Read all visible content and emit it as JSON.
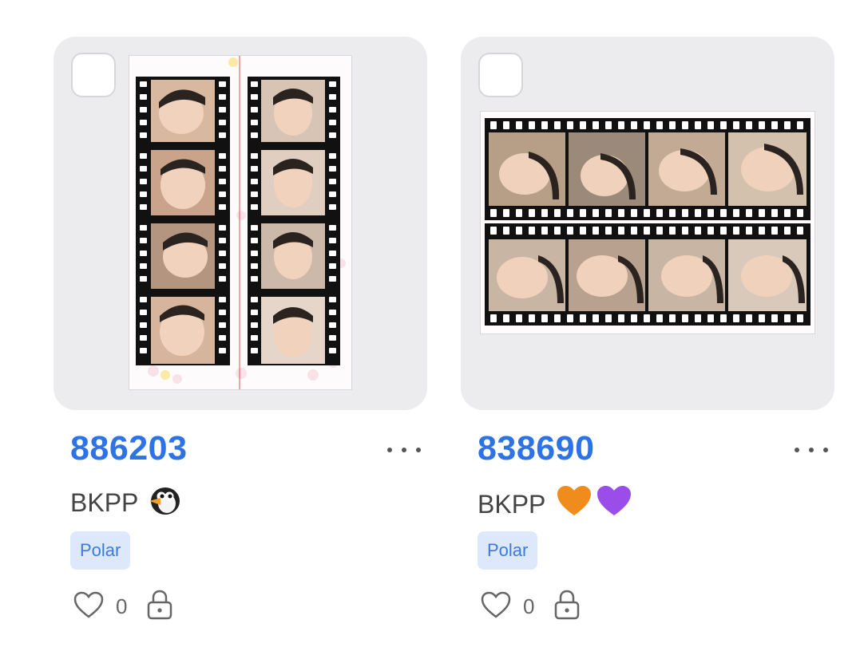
{
  "cards": [
    {
      "id": "886203",
      "title": "BKPP",
      "emojis": [
        "penguin"
      ],
      "tag": "Polar",
      "likes": "0",
      "orientation": "portrait"
    },
    {
      "id": "838690",
      "title": "BKPP",
      "emojis": [
        "orange-heart",
        "purple-heart"
      ],
      "tag": "Polar",
      "likes": "0",
      "orientation": "landscape"
    }
  ],
  "colors": {
    "accent": "#2e73e6",
    "tag_bg": "#dde9fb",
    "tag_text": "#3a7be0",
    "thumb_bg": "#ececee"
  }
}
